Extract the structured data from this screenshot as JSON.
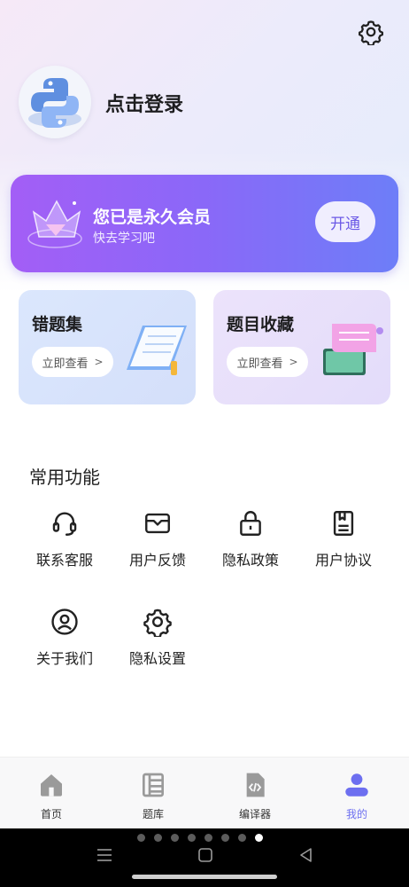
{
  "header": {
    "settings_icon": "gear-icon",
    "avatar_icon": "python-logo-avatar",
    "login_text": "点击登录"
  },
  "vip": {
    "icon": "crown-diamond-icon",
    "title": "您已是永久会员",
    "subtitle": "快去学习吧",
    "button_label": "开通",
    "colors": {
      "start": "#a35ef6",
      "end": "#6d7ef8"
    }
  },
  "quick_cards": [
    {
      "title": "错题集",
      "button_label": "立即查看",
      "arrow": ">",
      "icon": "notebook-pencil-illustration"
    },
    {
      "title": "题目收藏",
      "button_label": "立即查看",
      "arrow": ">",
      "icon": "tablet-scroll-illustration"
    }
  ],
  "common_functions": {
    "title": "常用功能",
    "items": [
      {
        "label": "联系客服",
        "icon": "headset-icon"
      },
      {
        "label": "用户反馈",
        "icon": "feedback-envelope-icon"
      },
      {
        "label": "隐私政策",
        "icon": "lock-icon"
      },
      {
        "label": "用户协议",
        "icon": "document-book-icon"
      },
      {
        "label": "关于我们",
        "icon": "user-circle-icon"
      },
      {
        "label": "隐私设置",
        "icon": "gear-icon"
      }
    ]
  },
  "bottom_nav": {
    "items": [
      {
        "label": "首页",
        "icon": "home-icon",
        "active": false
      },
      {
        "label": "题库",
        "icon": "question-bank-icon",
        "active": false
      },
      {
        "label": "编译器",
        "icon": "code-file-icon",
        "active": false
      },
      {
        "label": "我的",
        "icon": "person-icon",
        "active": true
      }
    ],
    "active_color": "#6d6ff0"
  },
  "system_bar": {
    "page_dots": 8,
    "active_dot": 8,
    "buttons": [
      "menu-icon",
      "home-square-icon",
      "back-triangle-icon"
    ]
  }
}
